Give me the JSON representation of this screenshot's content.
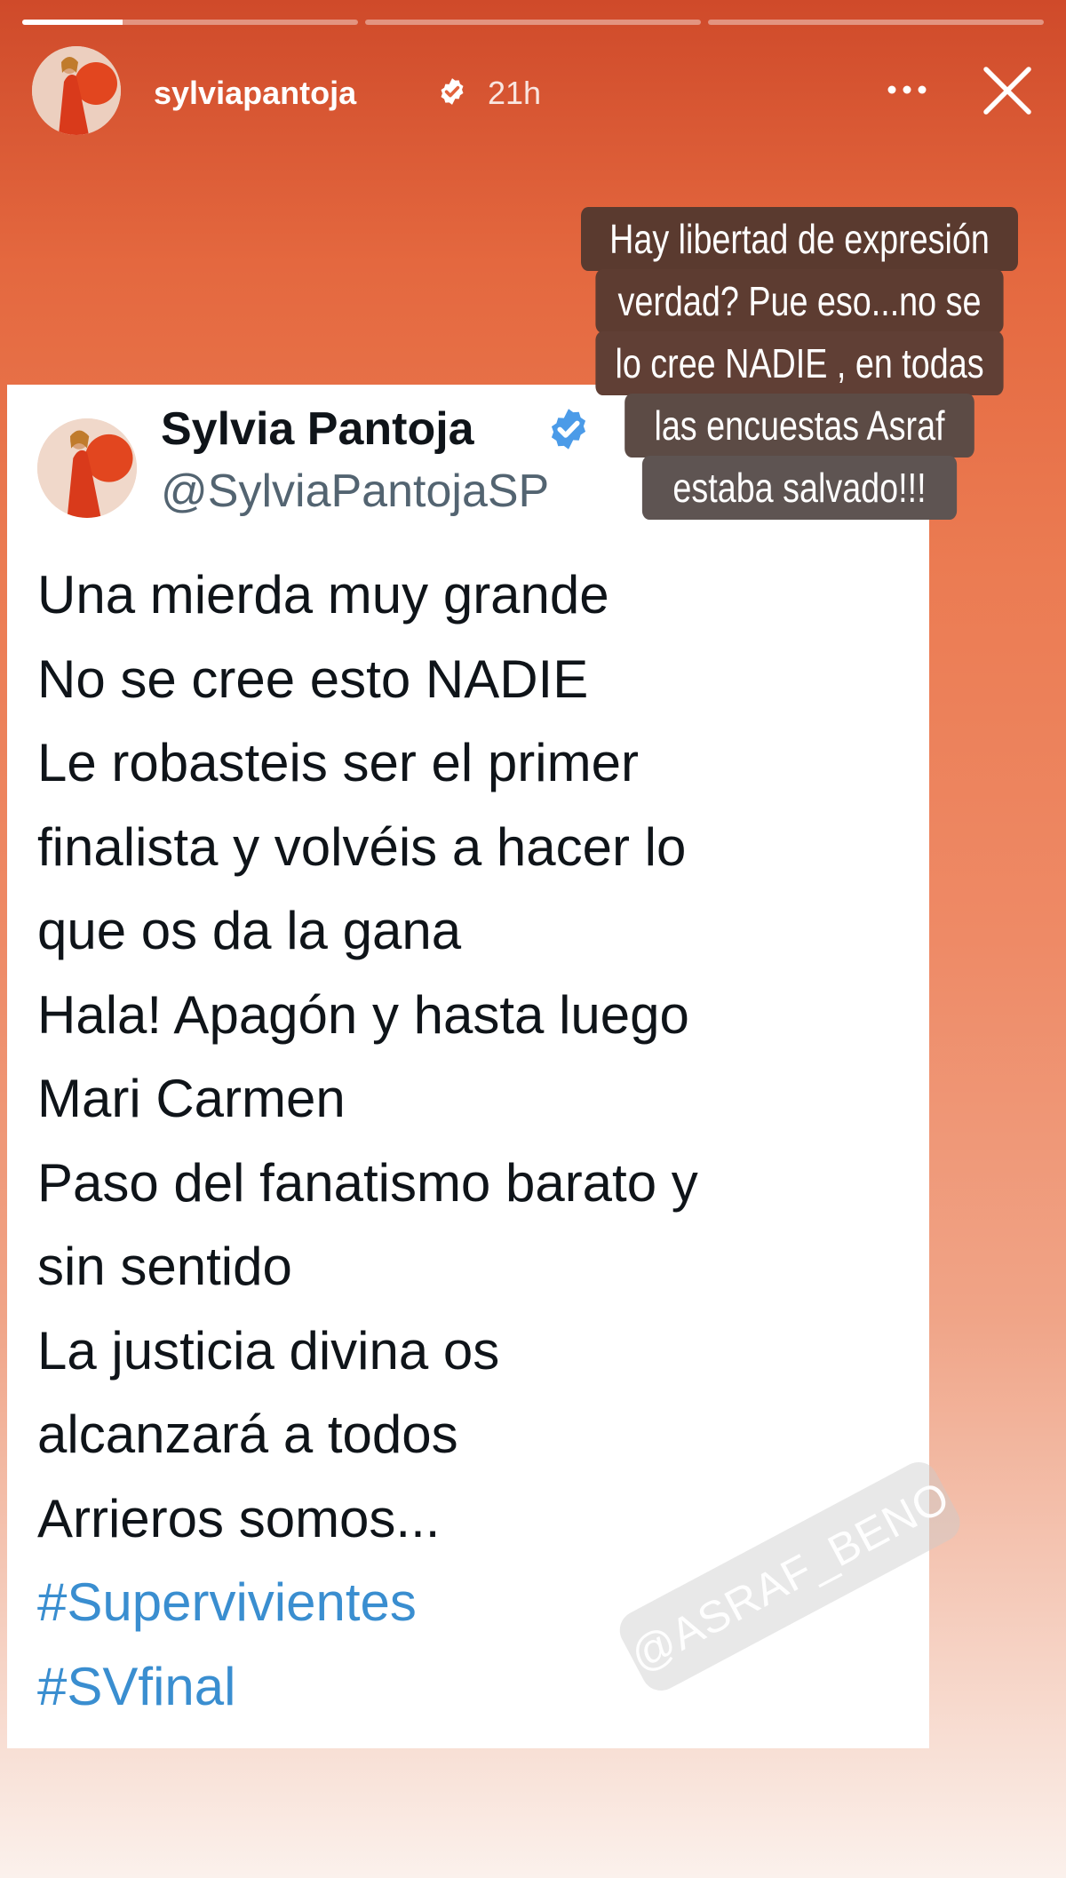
{
  "story": {
    "progress": {
      "segments": 3,
      "active_index": 0,
      "active_fill": 0.3
    },
    "username": "sylviapantoja",
    "time_ago": "21h",
    "overlay_lines": [
      "Hay libertad de expresión",
      "verdad? Pue eso...no se",
      "lo cree NADIE , en todas",
      "las encuestas Asraf",
      "estaba salvado!!!"
    ],
    "watermark": "@ASRAF_BENO"
  },
  "tweet": {
    "display_name": "Sylvia Pantoja",
    "handle": "@SylviaPantojaSP",
    "lines": [
      "Una mierda muy grande",
      "No se cree esto NADIE",
      "Le robasteis ser el primer",
      "finalista y volvéis a hacer lo",
      "que os da la gana",
      "Hala! Apagón y hasta luego",
      "Mari Carmen",
      "Paso del fanatismo barato y",
      "sin sentido",
      "La justicia divina os",
      "alcanzará a todos",
      "Arrieros somos..."
    ],
    "hashtags": [
      "#Supervivientes",
      "#SVfinal"
    ]
  },
  "colors": {
    "background_top": "#cf4a2a",
    "background_bottom": "#fbf1ec",
    "verified_blue": "#4b9be8",
    "hashtag_blue": "#3a8ed0",
    "overlay_bg": "#5b4137"
  },
  "icons": {
    "verified": "verified-badge-icon",
    "more": "more-horizontal-icon",
    "close": "close-icon"
  }
}
